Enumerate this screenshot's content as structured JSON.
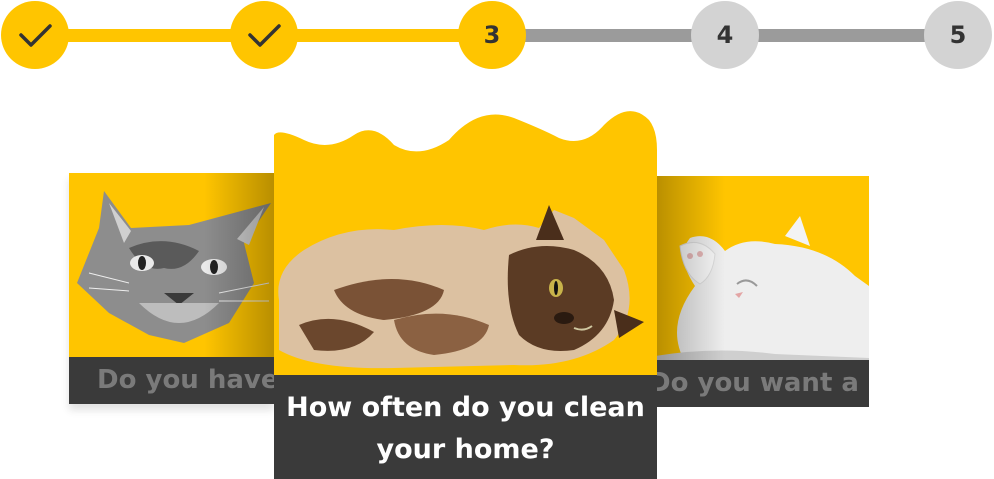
{
  "stepper": {
    "steps": [
      {
        "label": "",
        "state": "done"
      },
      {
        "label": "",
        "state": "done"
      },
      {
        "label": "3",
        "state": "active"
      },
      {
        "label": "4",
        "state": "todo"
      },
      {
        "label": "5",
        "state": "todo"
      }
    ]
  },
  "cards": {
    "left": {
      "caption": "Do you have",
      "image": "tabby-cat-head"
    },
    "center": {
      "caption": "How often do you clean your home?",
      "image": "siamese-cat-lying"
    },
    "right": {
      "caption": "Do you want a",
      "image": "white-cat-covering-face"
    }
  },
  "colors": {
    "accent": "#ffc500",
    "pending": "#d3d3d3",
    "track_pending": "#9b9b9b",
    "caption_bg": "#3a3a3a"
  }
}
